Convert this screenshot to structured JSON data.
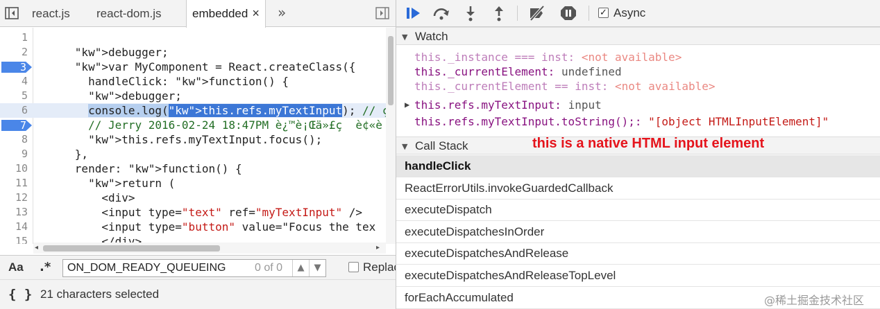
{
  "tabs": [
    {
      "label": "react.js"
    },
    {
      "label": "react-dom.js"
    },
    {
      "label": "embedded",
      "close": "×"
    }
  ],
  "tabs_more": "»",
  "code_lines": [
    {
      "n": "1",
      "html": ""
    },
    {
      "n": "2",
      "html": "      debugger;"
    },
    {
      "n": "3",
      "html": "      var MyComponent = React.createClass({",
      "bp": true
    },
    {
      "n": "4",
      "html": "        handleClick: function() {"
    },
    {
      "n": "5",
      "html": "        debugger;"
    },
    {
      "n": "6",
      "html": "        console.log(this.refs.myTextInput); // çœŸå"
    },
    {
      "n": "7",
      "html": "        // Jerry 2016-02-24 18:47PM è¿™è¡Œä»£ç  è¢«è",
      "bp": true
    },
    {
      "n": "8",
      "html": "        this.refs.myTextInput.focus();"
    },
    {
      "n": "9",
      "html": "      },"
    },
    {
      "n": "10",
      "html": "      render: function() {"
    },
    {
      "n": "11",
      "html": "        return ("
    },
    {
      "n": "12",
      "html": "          <div>"
    },
    {
      "n": "13",
      "html": "          <input type=\"text\" ref=\"myTextInput\" />"
    },
    {
      "n": "14",
      "html": "          <input type=\"button\" value=\"Focus the tex"
    },
    {
      "n": "15",
      "html": "          </div>"
    }
  ],
  "search": {
    "case_label": "Aa",
    "regex_label": ".*",
    "value": "ON_DOM_READY_QUEUEING",
    "count": "0 of 0",
    "replace_label": "Replace"
  },
  "status": {
    "braces": "{ }",
    "text": "21 characters selected"
  },
  "toolbar": {
    "async_label": "Async",
    "async_checked": "✓"
  },
  "watch": {
    "title": "Watch",
    "items": [
      {
        "expr": "this._instance === inst:",
        "value": "<not available>",
        "kind": "na",
        "dim": true
      },
      {
        "expr": "this._currentElement:",
        "value": "undefined",
        "kind": "val",
        "dim": false
      },
      {
        "expr": "this._currentElement == inst:",
        "value": "<not available>",
        "kind": "na",
        "dim": true
      },
      {
        "expr": "this.refs.myTextInput:",
        "value": "input",
        "kind": "val",
        "dim": false,
        "expandable": true
      },
      {
        "expr": "this.refs.myTextInput.toString();:",
        "value": "\"[object HTMLInputElement]\"",
        "kind": "str",
        "dim": false
      }
    ]
  },
  "annotation": "this is a native HTML input element",
  "callstack": {
    "title": "Call Stack",
    "frames": [
      "handleClick",
      "ReactErrorUtils.invokeGuardedCallback",
      "executeDispatch",
      "executeDispatchesInOrder",
      "executeDispatchesAndRelease",
      "executeDispatchesAndReleaseTopLevel",
      "forEachAccumulated"
    ]
  },
  "watermark": "@稀土掘金技术社区"
}
